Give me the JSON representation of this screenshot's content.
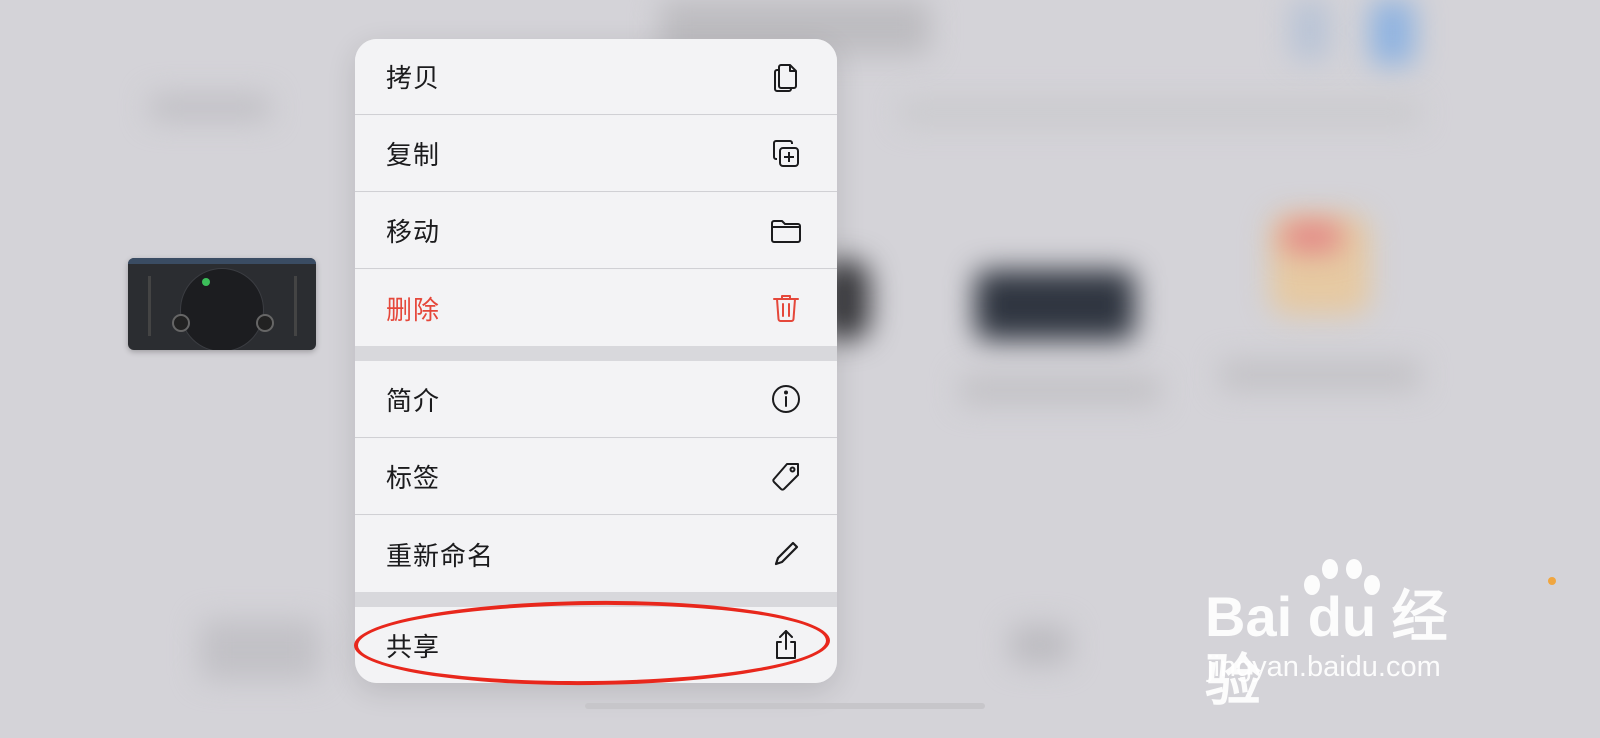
{
  "menu": {
    "items": [
      {
        "label": "拷贝",
        "icon": "copy-icon"
      },
      {
        "label": "复制",
        "icon": "duplicate-icon"
      },
      {
        "label": "移动",
        "icon": "folder-icon"
      },
      {
        "label": "删除",
        "icon": "trash-icon",
        "color": "#e5473a"
      },
      {
        "label": "简介",
        "icon": "info-icon"
      },
      {
        "label": "标签",
        "icon": "tag-icon"
      },
      {
        "label": "重新命名",
        "icon": "pencil-icon"
      },
      {
        "label": "共享",
        "icon": "share-icon"
      }
    ]
  },
  "annotation": {
    "color": "#e8271c",
    "target": "共享"
  },
  "watermark": {
    "brand": "Bai du 经验",
    "url": "jingyan.baidu.com"
  }
}
